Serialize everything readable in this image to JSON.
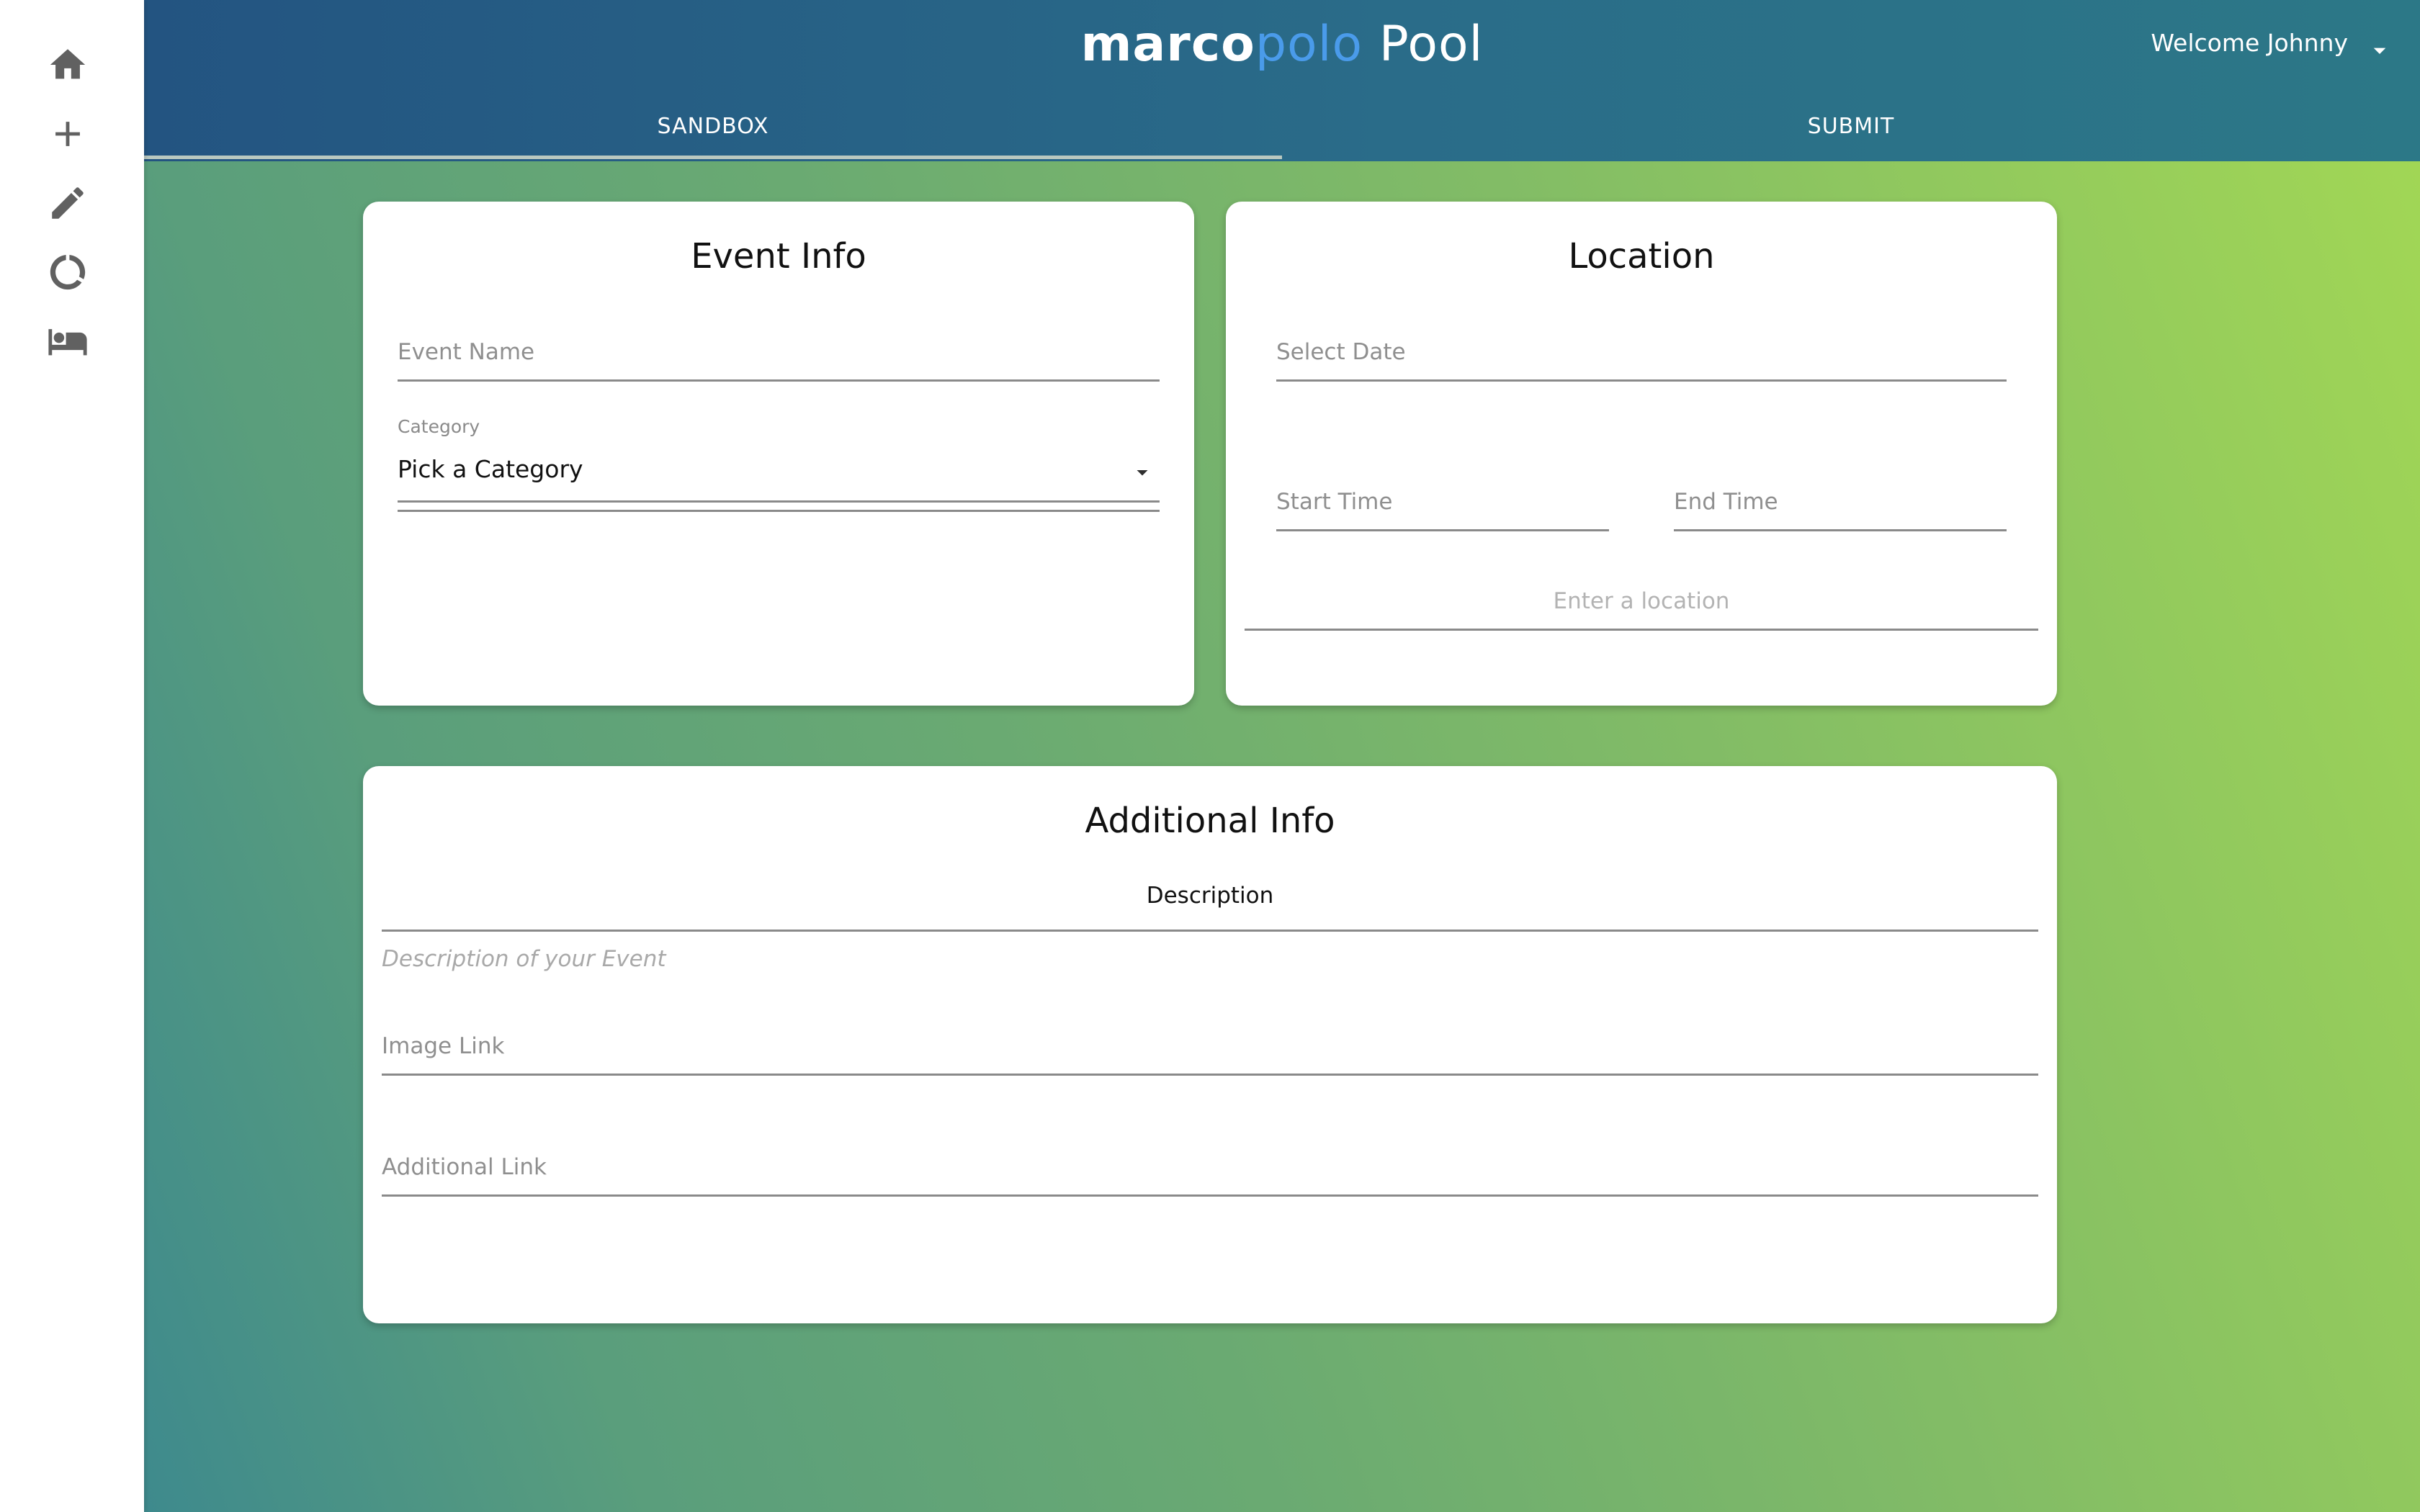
{
  "sidebar": {
    "items": [
      {
        "icon": "home-icon"
      },
      {
        "icon": "plus-icon"
      },
      {
        "icon": "pencil-icon"
      },
      {
        "icon": "loading-circle-icon"
      },
      {
        "icon": "bed-icon"
      }
    ]
  },
  "header": {
    "brand_part1": "marco",
    "brand_part2": "polo",
    "brand_part3": " Pool",
    "welcome": "Welcome Johnny",
    "tabs": [
      {
        "label": "SANDBOX",
        "active": true
      },
      {
        "label": "SUBMIT",
        "active": false
      }
    ]
  },
  "event_info": {
    "title": "Event Info",
    "event_name_placeholder": "Event Name",
    "category_label": "Category",
    "category_value": "Pick a Category"
  },
  "location": {
    "title": "Location",
    "date_placeholder": "Select Date",
    "start_time_placeholder": "Start Time",
    "end_time_placeholder": "End Time",
    "location_placeholder": "Enter a location"
  },
  "additional_info": {
    "title": "Additional Info",
    "description_label": "Description",
    "description_placeholder": "Description of your Event",
    "image_link_placeholder": "Image Link",
    "additional_link_placeholder": "Additional Link"
  },
  "colors": {
    "header_start": "#235481",
    "header_end": "#2c7887",
    "brand_accent": "#4a9bea",
    "bg_gradient_start": "#3e8a8d",
    "bg_gradient_end": "#a3d854"
  }
}
